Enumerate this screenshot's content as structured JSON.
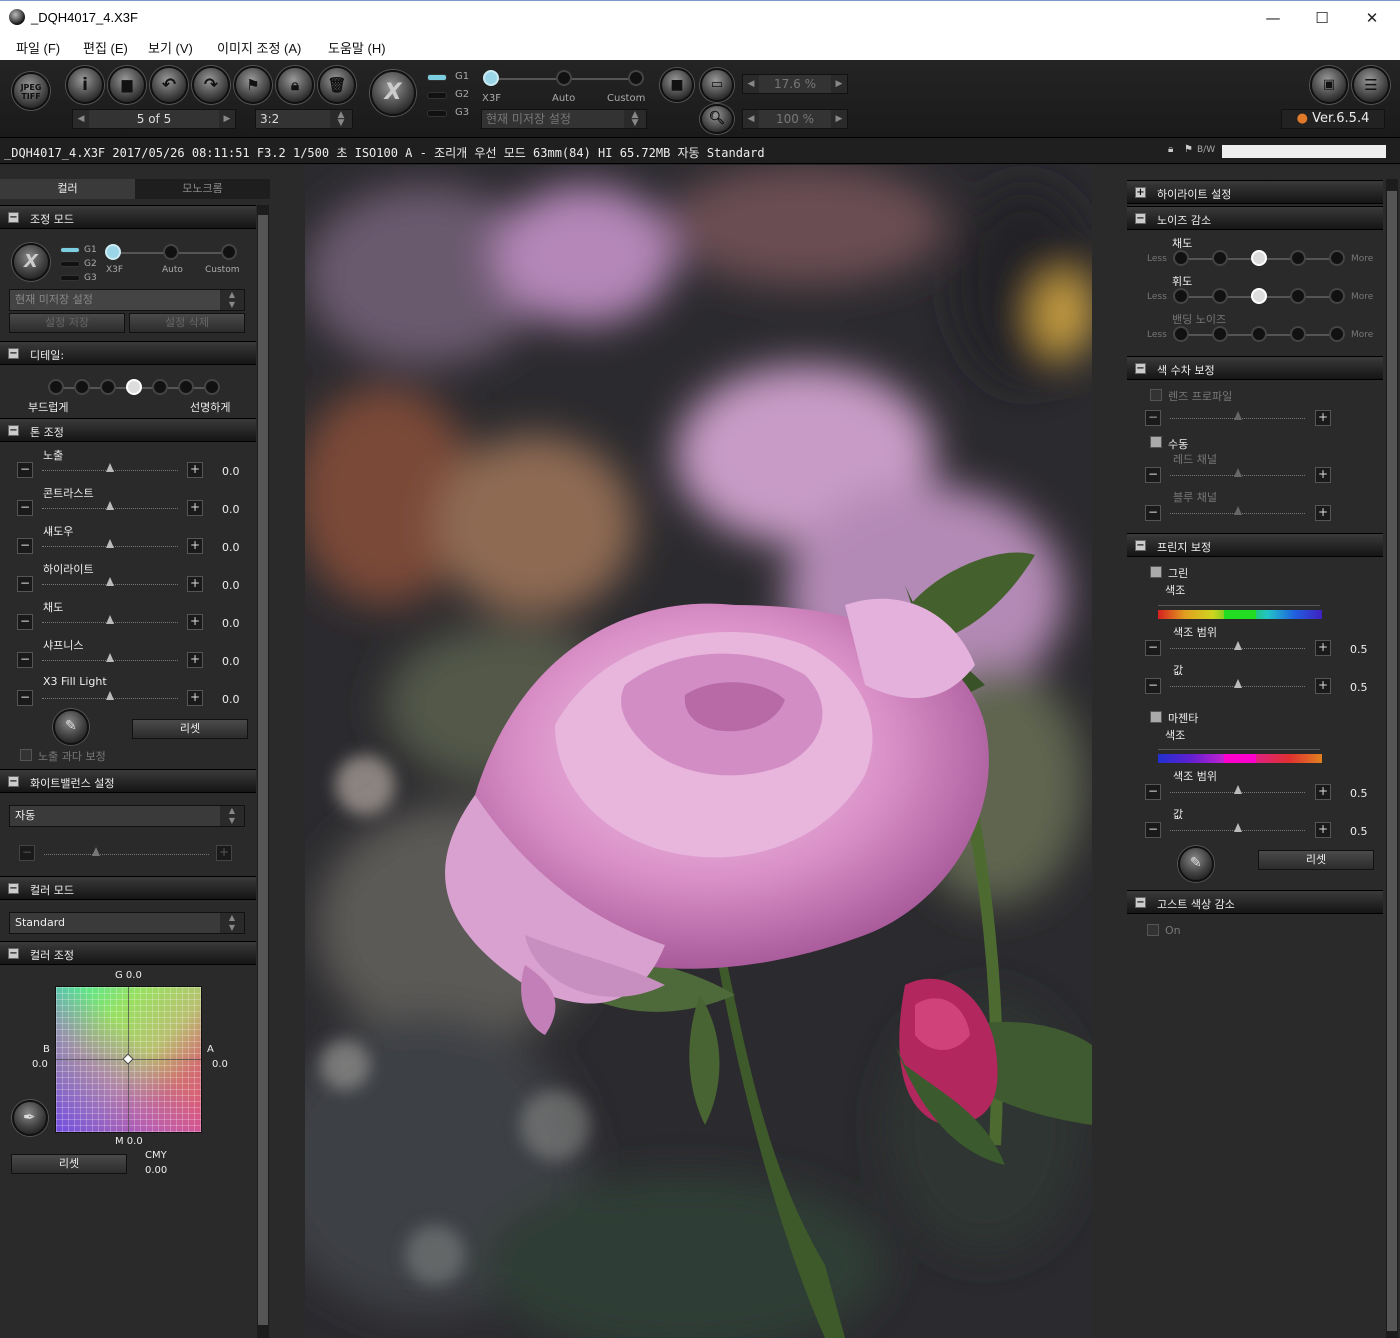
{
  "window": {
    "title": "_DQH4017_4.X3F"
  },
  "menu": [
    "파일 (F)",
    "편집 (E)",
    "보기 (V)",
    "이미지 조정 (A)",
    "도움말 (H)"
  ],
  "toolbar": {
    "jpeg_tiff": "JPEG\nTIFF",
    "nav_counter": "5 of 5",
    "aspect_ratio": "3:2",
    "g_labels": [
      "G1",
      "G2",
      "G3"
    ],
    "mode_labels": [
      "X3F",
      "Auto",
      "Custom"
    ],
    "preset_select": "현재 미저장 설정",
    "zoom_fit": "17.6 %",
    "zoom_100": "100 %",
    "version": "Ver.6.5.4"
  },
  "infobar": {
    "text": "_DQH4017_4.X3F 2017/05/26 08:11:51 F3.2 1/500 초 ISO100 A - 조리개 우선 모드 63mm(84) HI 65.72MB 자동 Standard",
    "bw_label": "B/W"
  },
  "left": {
    "tabs": [
      "컬러",
      "모노크롬"
    ],
    "adjust_mode": {
      "title": "조정 모드",
      "g_labels": [
        "G1",
        "G2",
        "G3"
      ],
      "mode_labels": [
        "X3F",
        "Auto",
        "Custom"
      ],
      "preset": "현재 미저장 설정",
      "save_btn": "설정 저장",
      "delete_btn": "설정 삭제"
    },
    "detail": {
      "title": "디테일:",
      "left_label": "부드럽게",
      "right_label": "선명하게",
      "level": 4,
      "levels": 7
    },
    "tone": {
      "title": "톤 조정",
      "sliders": [
        {
          "label": "노출",
          "value": "0.0"
        },
        {
          "label": "콘트라스트",
          "value": "0.0"
        },
        {
          "label": "섀도우",
          "value": "0.0"
        },
        {
          "label": "하이라이트",
          "value": "0.0"
        },
        {
          "label": "채도",
          "value": "0.0"
        },
        {
          "label": "샤프니스",
          "value": "0.0"
        },
        {
          "label": "X3 Fill Light",
          "value": "0.0"
        }
      ],
      "reset": "리셋",
      "overexposure": "노출 과다 보정"
    },
    "wb": {
      "title": "화이트밸런스 설정",
      "value": "자동"
    },
    "color_mode": {
      "title": "컬러 모드",
      "value": "Standard"
    },
    "color_adjust": {
      "title": "컬러 조정",
      "g": "G 0.0",
      "m": "M 0.0",
      "b_label": "B",
      "b_value": "0.0",
      "a_label": "A",
      "a_value": "0.0",
      "reset": "리셋",
      "cmy_label": "CMY",
      "cmy_value": "0.00"
    }
  },
  "right": {
    "highlight": {
      "title": "하이라이트 설정"
    },
    "noise": {
      "title": "노이즈 감소",
      "less": "Less",
      "more": "More",
      "rows": [
        {
          "label": "채도",
          "level": 3
        },
        {
          "label": "휘도",
          "level": 3
        },
        {
          "label": "밴딩 노이즈",
          "level": 0
        }
      ]
    },
    "ca": {
      "title": "색 수차 보정",
      "lens_profile": "렌즈 프로파일",
      "manual": "수동",
      "red_channel": "레드 채널",
      "blue_channel": "블루 채널"
    },
    "fringe": {
      "title": "프린지 보정",
      "green": "그린",
      "magenta": "마젠타",
      "hue": "색조",
      "hue_range": "색조 범위",
      "amount": "값",
      "green_range": "0.5",
      "green_amount": "0.5",
      "magenta_range": "0.5",
      "magenta_amount": "0.5",
      "reset": "리셋"
    },
    "ghost": {
      "title": "고스트 색상 감소",
      "on": "On"
    }
  },
  "colors": {
    "accent": "#7ccfe0",
    "version_dot": "#e07a2a",
    "green_band": "#22dd22",
    "magenta_band": "#ff00cc"
  }
}
